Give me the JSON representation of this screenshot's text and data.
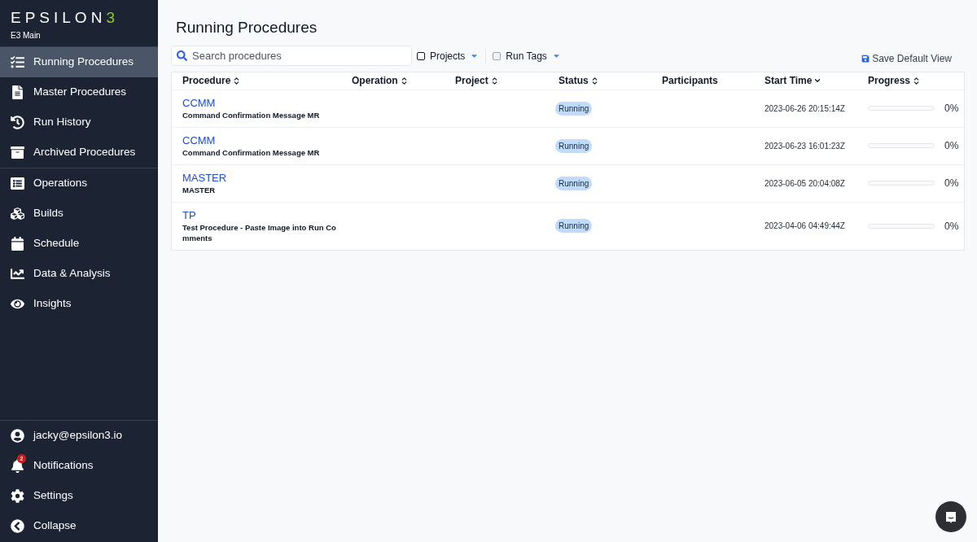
{
  "brand": {
    "wordmark": "EPSILON",
    "accent": "3",
    "workspace": "E3 Main"
  },
  "sidebar": {
    "groups": [
      [
        {
          "label": "Running Procedures",
          "selected": true
        },
        {
          "label": "Master Procedures",
          "selected": false
        },
        {
          "label": "Run History",
          "selected": false
        },
        {
          "label": "Archived Procedures",
          "selected": false
        }
      ],
      [
        {
          "label": "Operations",
          "selected": false
        },
        {
          "label": "Builds",
          "selected": false
        },
        {
          "label": "Schedule",
          "selected": false
        },
        {
          "label": "Data & Analysis",
          "selected": false
        },
        {
          "label": "Insights",
          "selected": false
        }
      ]
    ],
    "footer": [
      {
        "label": "jacky@epsilon3.io"
      },
      {
        "label": "Notifications",
        "badge": "2"
      },
      {
        "label": "Settings"
      },
      {
        "label": "Collapse"
      }
    ]
  },
  "page": {
    "title": "Running Procedures",
    "search": {
      "placeholder": "Search procedures"
    },
    "filters": [
      {
        "label": "Projects",
        "checked": false
      },
      {
        "label": "Run Tags",
        "checked": false
      }
    ],
    "save_view": "Save Default View"
  },
  "table": {
    "columns": [
      {
        "label": "Procedure",
        "sortable": true,
        "sorted": false
      },
      {
        "label": "Operation",
        "sortable": true,
        "sorted": false
      },
      {
        "label": "Project",
        "sortable": true,
        "sorted": false
      },
      {
        "label": "Status",
        "sortable": true,
        "sorted": false
      },
      {
        "label": "Participants",
        "sortable": false,
        "sorted": false
      },
      {
        "label": "Start Time",
        "sortable": true,
        "sorted": true
      },
      {
        "label": "Progress",
        "sortable": true,
        "sorted": false
      }
    ],
    "rows": [
      {
        "code": "CCMM",
        "name": "Command Confirmation Message MR",
        "status": "Running",
        "start_time": "2023-06-26 20:15:14Z",
        "level": 0,
        "percent": "0%"
      },
      {
        "code": "CCMM",
        "name": "Command Confirmation Message MR",
        "status": "Running",
        "start_time": "2023-06-23 16:01:23Z",
        "level": 0,
        "percent": "0%"
      },
      {
        "code": "MASTER",
        "name": "MASTER",
        "status": "Running",
        "start_time": "2023-06-05 20:04:08Z",
        "level": 0,
        "percent": "0%"
      },
      {
        "code": "TP",
        "name": "Test Procedure - Paste Image into Run Comments",
        "status": "Running",
        "start_time": "2023-04-06 04:49:44Z",
        "level": 0,
        "percent": "0%"
      }
    ]
  }
}
